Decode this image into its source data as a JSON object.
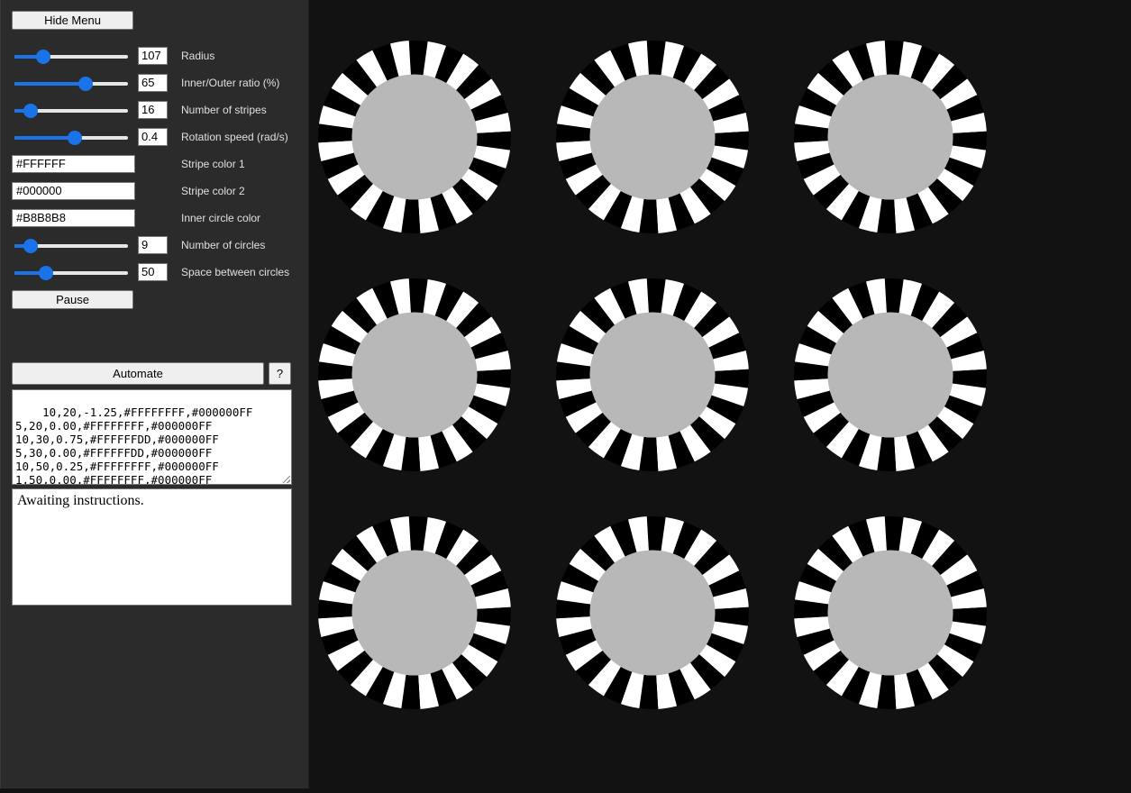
{
  "menu": {
    "hide_label": "Hide Menu",
    "pause_label": "Pause",
    "automate_label": "Automate",
    "help_label": "?"
  },
  "controls": {
    "radius": {
      "label": "Radius",
      "value": "107",
      "slider_fraction": 0.25
    },
    "ratio": {
      "label": "Inner/Outer ratio (%)",
      "value": "65",
      "slider_fraction": 0.63
    },
    "stripes": {
      "label": "Number of stripes",
      "value": "16",
      "slider_fraction": 0.14
    },
    "speed": {
      "label": "Rotation speed (rad/s)",
      "value": "0.4",
      "slider_fraction": 0.53
    },
    "stripe_color_1": {
      "label": "Stripe color 1",
      "value": "#FFFFFF"
    },
    "stripe_color_2": {
      "label": "Stripe color 2",
      "value": "#000000"
    },
    "inner_color": {
      "label": "Inner circle color",
      "value": "#B8B8B8"
    },
    "circles": {
      "label": "Number of circles",
      "value": "9",
      "slider_fraction": 0.14
    },
    "spacing": {
      "label": "Space between circles",
      "value": "50",
      "slider_fraction": 0.28
    }
  },
  "script_text": "10,20,-1.25,#FFFFFFFF,#000000FF\n5,20,0.00,#FFFFFFFF,#000000FF\n10,30,0.75,#FFFFFFDD,#000000FF\n5,30,0.00,#FFFFFFDD,#000000FF\n10,50,0.25,#FFFFFFFF,#000000FF\n1,50,0.00,#FFFFFFFF,#000000FF",
  "status_text": "Awaiting instructions.",
  "scene": {
    "circle_count": 9,
    "stripe_count": 16,
    "inner_outer_ratio": 0.65,
    "stripe_color_1": "#FFFFFF",
    "stripe_color_2": "#000000",
    "inner_color": "#B8B8B8",
    "background_color": "#121212"
  }
}
